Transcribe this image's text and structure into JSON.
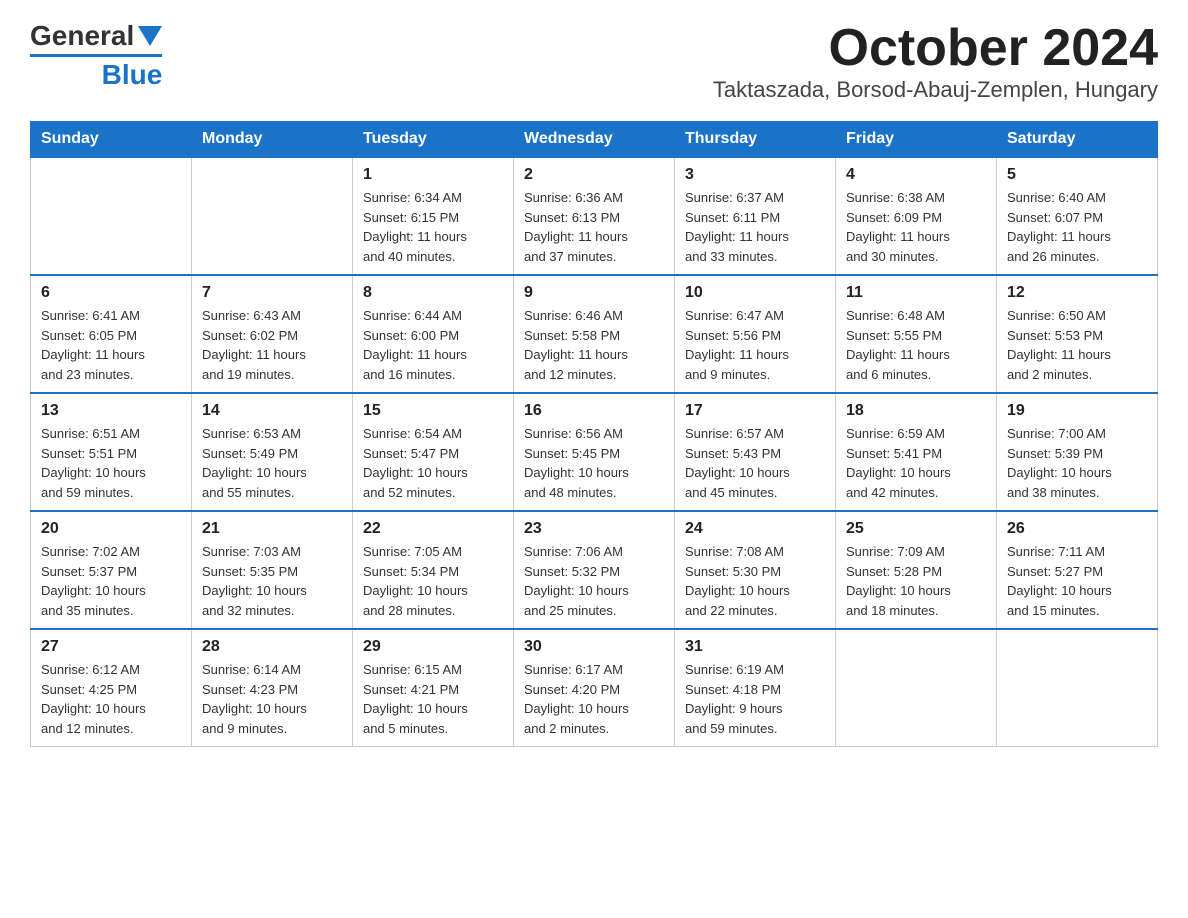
{
  "logo": {
    "general_text": "General",
    "blue_text": "Blue"
  },
  "header": {
    "month_year": "October 2024",
    "location": "Taktaszada, Borsod-Abauj-Zemplen, Hungary"
  },
  "weekdays": [
    "Sunday",
    "Monday",
    "Tuesday",
    "Wednesday",
    "Thursday",
    "Friday",
    "Saturday"
  ],
  "weeks": [
    [
      {
        "day": "",
        "info": ""
      },
      {
        "day": "",
        "info": ""
      },
      {
        "day": "1",
        "info": "Sunrise: 6:34 AM\nSunset: 6:15 PM\nDaylight: 11 hours\nand 40 minutes."
      },
      {
        "day": "2",
        "info": "Sunrise: 6:36 AM\nSunset: 6:13 PM\nDaylight: 11 hours\nand 37 minutes."
      },
      {
        "day": "3",
        "info": "Sunrise: 6:37 AM\nSunset: 6:11 PM\nDaylight: 11 hours\nand 33 minutes."
      },
      {
        "day": "4",
        "info": "Sunrise: 6:38 AM\nSunset: 6:09 PM\nDaylight: 11 hours\nand 30 minutes."
      },
      {
        "day": "5",
        "info": "Sunrise: 6:40 AM\nSunset: 6:07 PM\nDaylight: 11 hours\nand 26 minutes."
      }
    ],
    [
      {
        "day": "6",
        "info": "Sunrise: 6:41 AM\nSunset: 6:05 PM\nDaylight: 11 hours\nand 23 minutes."
      },
      {
        "day": "7",
        "info": "Sunrise: 6:43 AM\nSunset: 6:02 PM\nDaylight: 11 hours\nand 19 minutes."
      },
      {
        "day": "8",
        "info": "Sunrise: 6:44 AM\nSunset: 6:00 PM\nDaylight: 11 hours\nand 16 minutes."
      },
      {
        "day": "9",
        "info": "Sunrise: 6:46 AM\nSunset: 5:58 PM\nDaylight: 11 hours\nand 12 minutes."
      },
      {
        "day": "10",
        "info": "Sunrise: 6:47 AM\nSunset: 5:56 PM\nDaylight: 11 hours\nand 9 minutes."
      },
      {
        "day": "11",
        "info": "Sunrise: 6:48 AM\nSunset: 5:55 PM\nDaylight: 11 hours\nand 6 minutes."
      },
      {
        "day": "12",
        "info": "Sunrise: 6:50 AM\nSunset: 5:53 PM\nDaylight: 11 hours\nand 2 minutes."
      }
    ],
    [
      {
        "day": "13",
        "info": "Sunrise: 6:51 AM\nSunset: 5:51 PM\nDaylight: 10 hours\nand 59 minutes."
      },
      {
        "day": "14",
        "info": "Sunrise: 6:53 AM\nSunset: 5:49 PM\nDaylight: 10 hours\nand 55 minutes."
      },
      {
        "day": "15",
        "info": "Sunrise: 6:54 AM\nSunset: 5:47 PM\nDaylight: 10 hours\nand 52 minutes."
      },
      {
        "day": "16",
        "info": "Sunrise: 6:56 AM\nSunset: 5:45 PM\nDaylight: 10 hours\nand 48 minutes."
      },
      {
        "day": "17",
        "info": "Sunrise: 6:57 AM\nSunset: 5:43 PM\nDaylight: 10 hours\nand 45 minutes."
      },
      {
        "day": "18",
        "info": "Sunrise: 6:59 AM\nSunset: 5:41 PM\nDaylight: 10 hours\nand 42 minutes."
      },
      {
        "day": "19",
        "info": "Sunrise: 7:00 AM\nSunset: 5:39 PM\nDaylight: 10 hours\nand 38 minutes."
      }
    ],
    [
      {
        "day": "20",
        "info": "Sunrise: 7:02 AM\nSunset: 5:37 PM\nDaylight: 10 hours\nand 35 minutes."
      },
      {
        "day": "21",
        "info": "Sunrise: 7:03 AM\nSunset: 5:35 PM\nDaylight: 10 hours\nand 32 minutes."
      },
      {
        "day": "22",
        "info": "Sunrise: 7:05 AM\nSunset: 5:34 PM\nDaylight: 10 hours\nand 28 minutes."
      },
      {
        "day": "23",
        "info": "Sunrise: 7:06 AM\nSunset: 5:32 PM\nDaylight: 10 hours\nand 25 minutes."
      },
      {
        "day": "24",
        "info": "Sunrise: 7:08 AM\nSunset: 5:30 PM\nDaylight: 10 hours\nand 22 minutes."
      },
      {
        "day": "25",
        "info": "Sunrise: 7:09 AM\nSunset: 5:28 PM\nDaylight: 10 hours\nand 18 minutes."
      },
      {
        "day": "26",
        "info": "Sunrise: 7:11 AM\nSunset: 5:27 PM\nDaylight: 10 hours\nand 15 minutes."
      }
    ],
    [
      {
        "day": "27",
        "info": "Sunrise: 6:12 AM\nSunset: 4:25 PM\nDaylight: 10 hours\nand 12 minutes."
      },
      {
        "day": "28",
        "info": "Sunrise: 6:14 AM\nSunset: 4:23 PM\nDaylight: 10 hours\nand 9 minutes."
      },
      {
        "day": "29",
        "info": "Sunrise: 6:15 AM\nSunset: 4:21 PM\nDaylight: 10 hours\nand 5 minutes."
      },
      {
        "day": "30",
        "info": "Sunrise: 6:17 AM\nSunset: 4:20 PM\nDaylight: 10 hours\nand 2 minutes."
      },
      {
        "day": "31",
        "info": "Sunrise: 6:19 AM\nSunset: 4:18 PM\nDaylight: 9 hours\nand 59 minutes."
      },
      {
        "day": "",
        "info": ""
      },
      {
        "day": "",
        "info": ""
      }
    ]
  ]
}
